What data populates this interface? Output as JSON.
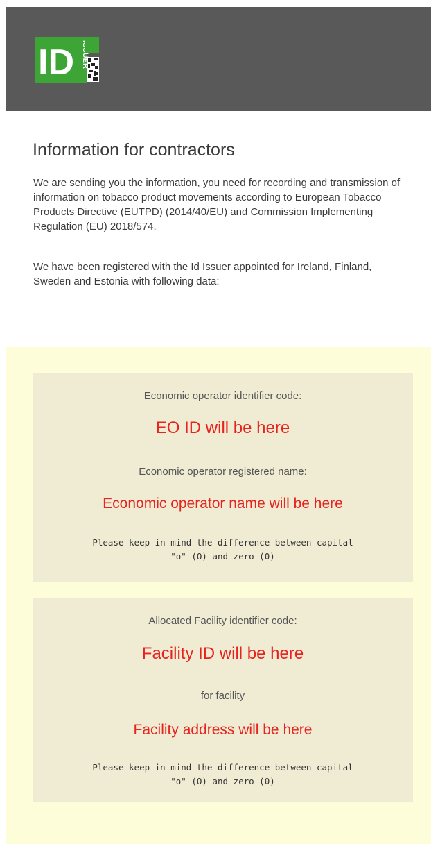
{
  "header": {
    "logo": {
      "id_text": "ID",
      "issuer_text": "ISSUER",
      "colors": {
        "green": "#3da535",
        "white": "#ffffff",
        "dark": "#222222"
      }
    },
    "background": "#595959"
  },
  "intro": {
    "title": "Information for contractors",
    "paragraph_1": "We are sending you the information, you need for recording and transmission of information on tobacco product movements according to European Tobacco Products Directive (EUTPD) (2014/40/EU) and Commission Implementing Regulation (EU) 2018/574.",
    "paragraph_2": "We have been registered with the Id Issuer appointed for Ireland, Finland, Sweden and Estonia with following data:"
  },
  "operator_box": {
    "id_label": "Economic operator identifier code:",
    "id_value": "EO ID will be here",
    "name_label": "Economic operator registered name:",
    "name_value": "Economic operator name will be here",
    "note_line_1": "Please keep in mind the difference between capital",
    "note_line_2": "\"o\" (O) and zero (0)"
  },
  "facility_box": {
    "id_label": "Allocated Facility identifier code:",
    "id_value": "Facility ID will be here",
    "for_label": "for facility",
    "address_value": "Facility address will be here",
    "note_line_1": "Please keep in mind the difference between capital",
    "note_line_2": "\"o\" (O) and zero (0)"
  },
  "colors": {
    "header_bg": "#595959",
    "highlight_bg": "#fdfdd9",
    "box_bg": "#efecd3",
    "value_red": "#e8231f",
    "text_dark": "#3a3a3a",
    "label_gray": "#555555"
  }
}
